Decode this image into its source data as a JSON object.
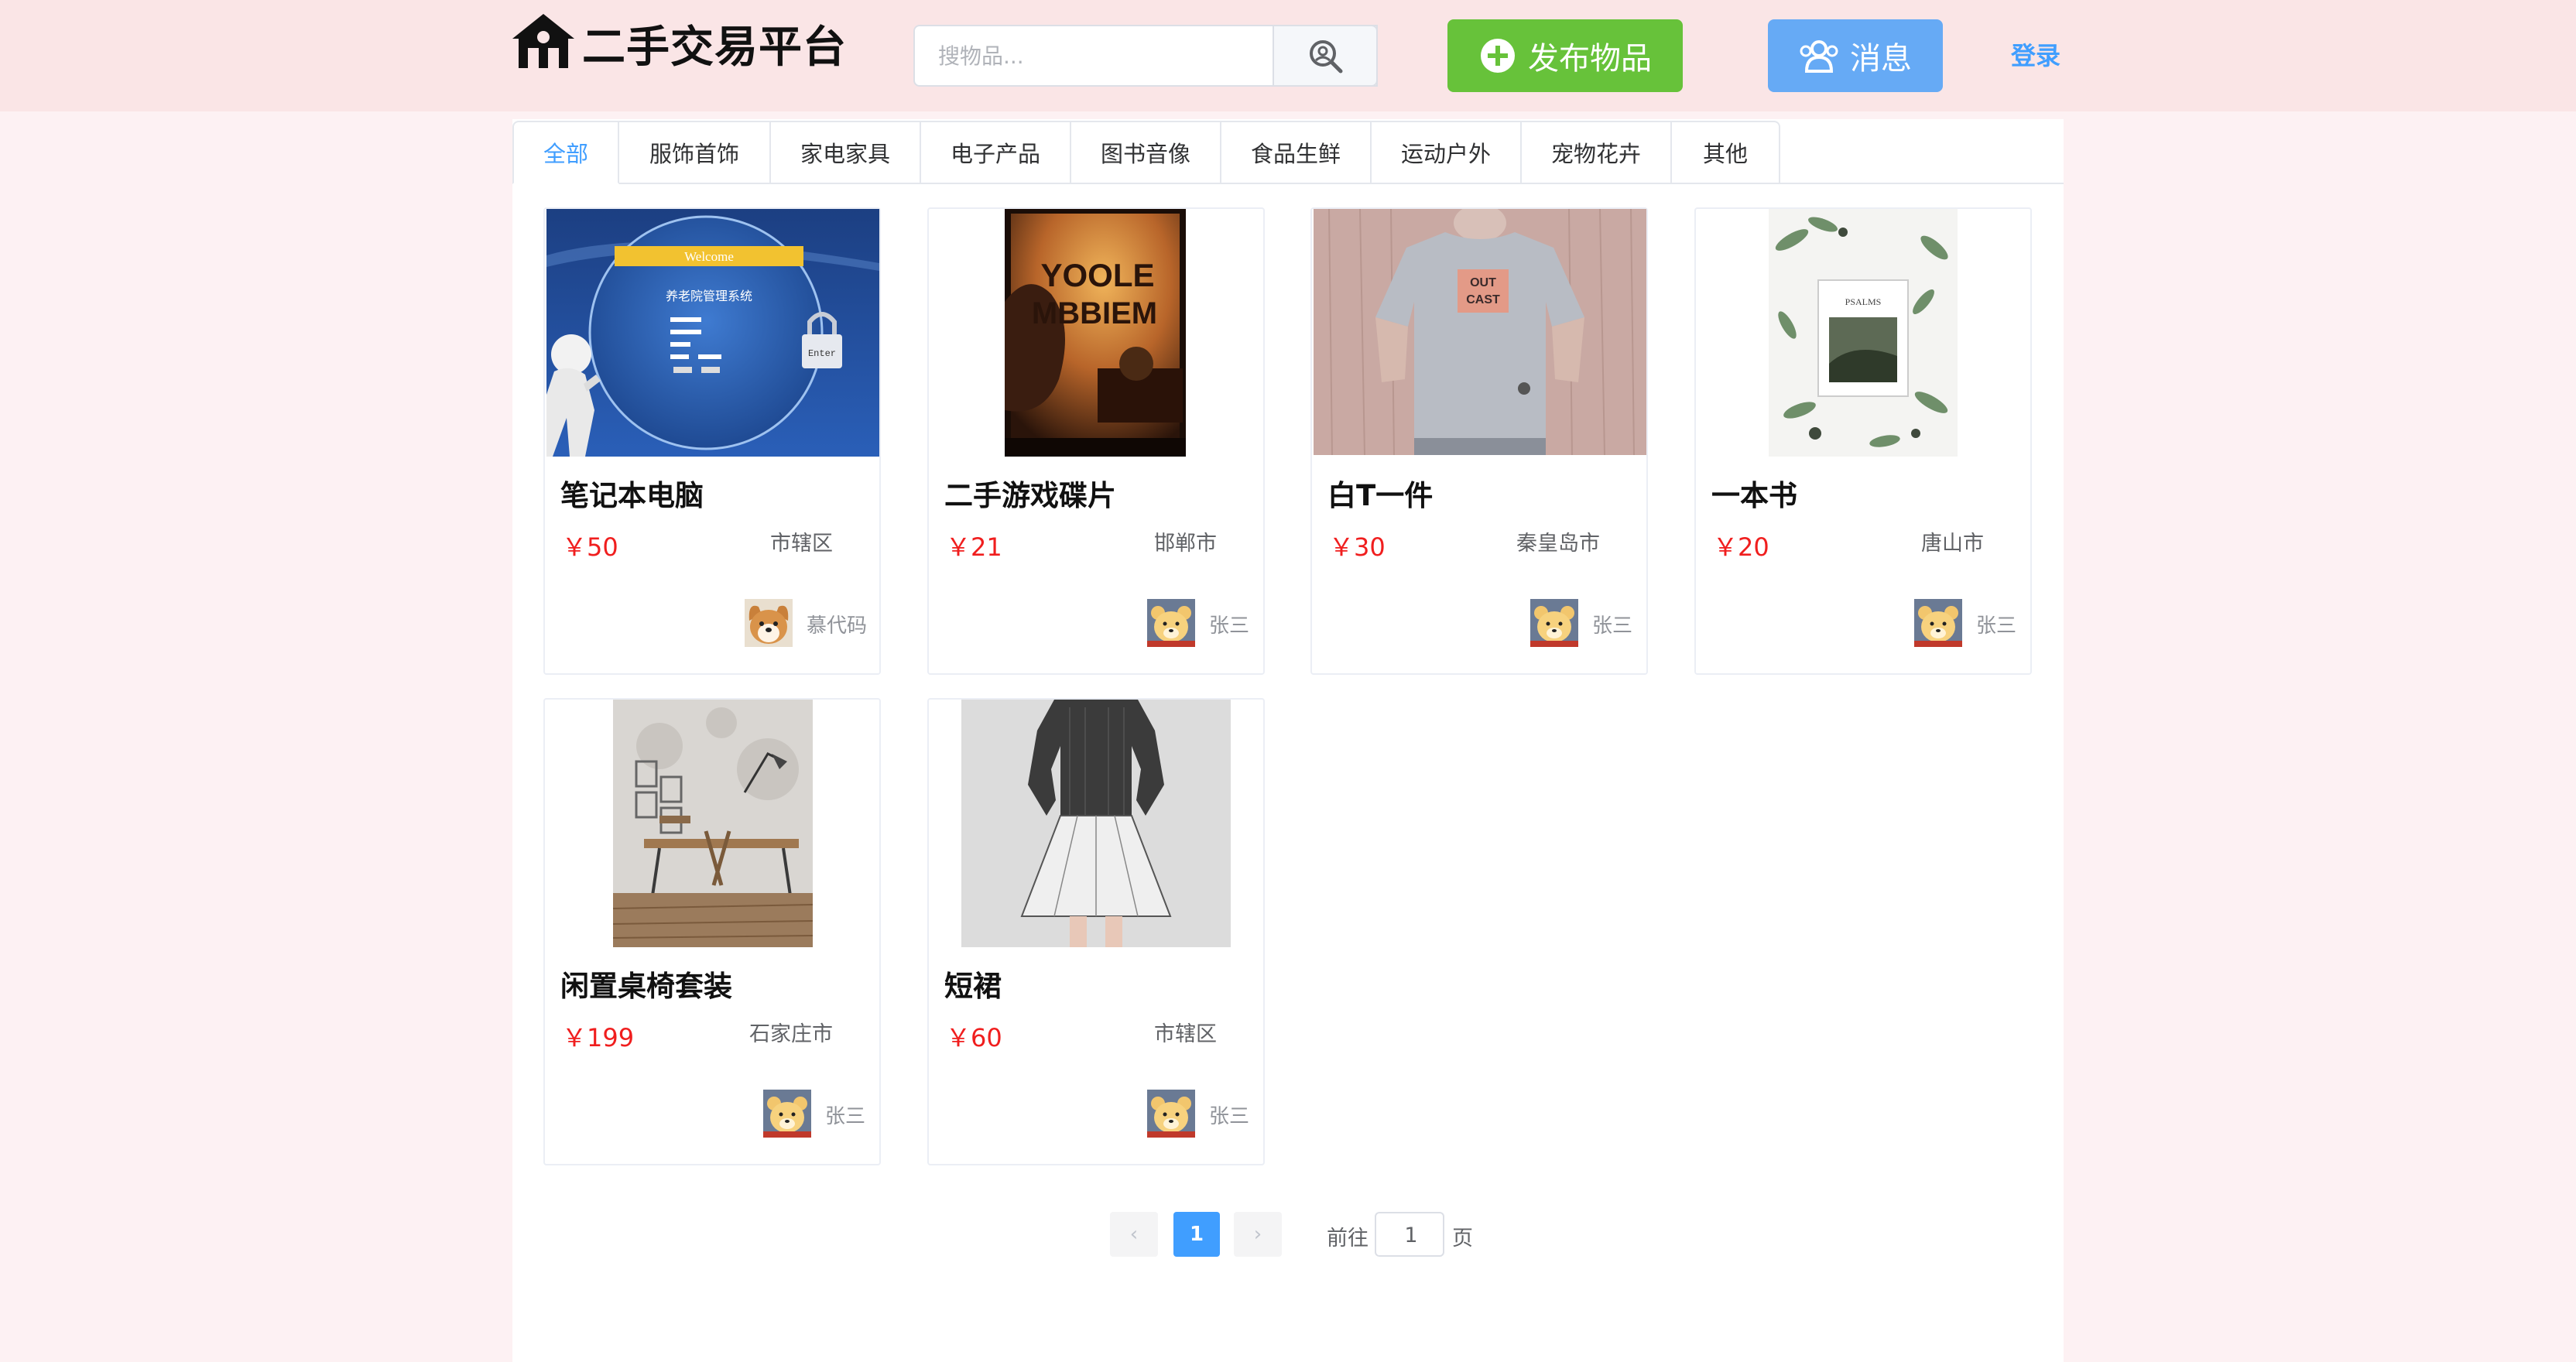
{
  "header": {
    "logo_text": "二手交易平台",
    "search_placeholder": "搜物品...",
    "publish_label": "发布物品",
    "message_label": "消息",
    "login_label": "登录"
  },
  "tabs": [
    "全部",
    "服饰首饰",
    "家电家具",
    "电子产品",
    "图书音像",
    "食品生鲜",
    "运动户外",
    "宠物花卉",
    "其他"
  ],
  "active_tab": "全部",
  "items": [
    {
      "title": "笔记本电脑",
      "price": "￥50",
      "location": "市辖区",
      "user": "慕代码",
      "avatar": "dog-avatar",
      "image_texts": [
        "Welcome",
        "养老院管理系统",
        "Enter"
      ]
    },
    {
      "title": "二手游戏碟片",
      "price": "￥21",
      "location": "邯郸市",
      "user": "张三",
      "avatar": "bear-avatar",
      "image_texts": [
        "YOOLE",
        "MBBIEM"
      ]
    },
    {
      "title": "白T一件",
      "price": "￥30",
      "location": "秦皇岛市",
      "user": "张三",
      "avatar": "bear-avatar",
      "image_texts": [
        "OUT",
        "CAST"
      ]
    },
    {
      "title": "一本书",
      "price": "￥20",
      "location": "唐山市",
      "user": "张三",
      "avatar": "bear-avatar",
      "image_texts": [
        "PSALMS"
      ]
    },
    {
      "title": "闲置桌椅套装",
      "price": "￥199",
      "location": "石家庄市",
      "user": "张三",
      "avatar": "bear-avatar"
    },
    {
      "title": "短裙",
      "price": "￥60",
      "location": "市辖区",
      "user": "张三",
      "avatar": "bear-avatar"
    }
  ],
  "pagination": {
    "prev": "‹",
    "next": "›",
    "current_page": "1",
    "goto_label": "前往",
    "goto_value": "1",
    "page_suffix": "页"
  },
  "colors": {
    "header_bg": "#fae5e6",
    "page_bg": "#fdf1f3",
    "publish_green": "#67c23a",
    "message_blue": "#66aaf5",
    "link_blue": "#409eff",
    "price_red": "#f01e1e"
  }
}
